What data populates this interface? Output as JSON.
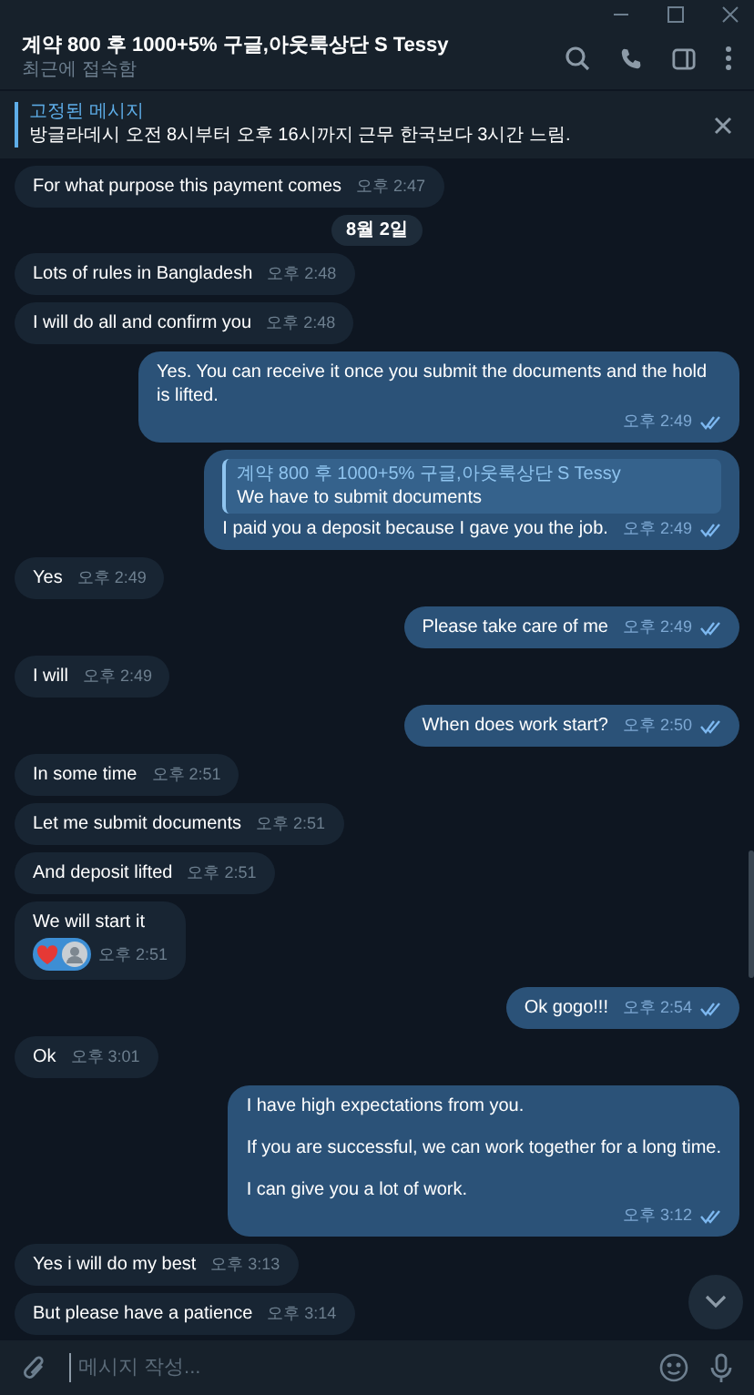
{
  "header": {
    "title": "계약 800 후 1000+5% 구글,아웃룩상단 S Tessy",
    "status": "최근에 접속함"
  },
  "pinned": {
    "label": "고정된 메시지",
    "text": "방글라데시  오전 8시부터 오후 16시까지 근무 한국보다 3시간 느림."
  },
  "messages": [
    {
      "kind": "in",
      "paragraphs": [
        "For what purpose this payment comes"
      ],
      "time": "오후 2:47"
    },
    {
      "kind": "date",
      "text": "8월 2일"
    },
    {
      "kind": "in",
      "paragraphs": [
        "Lots of rules in Bangladesh"
      ],
      "time": "오후 2:48"
    },
    {
      "kind": "in",
      "paragraphs": [
        "I will do all and confirm you"
      ],
      "time": "오후 2:48"
    },
    {
      "kind": "out",
      "paragraphs": [
        "Yes. You can receive it once you submit the documents and the hold is lifted."
      ],
      "time": "오후 2:49",
      "read": true
    },
    {
      "kind": "out",
      "reply": {
        "author": "계약 800 후 1000+5% 구글,아웃룩상단 S Tessy",
        "text": "We have to submit documents"
      },
      "paragraphs": [
        "I paid you a deposit because I gave you the job."
      ],
      "time": "오후 2:49",
      "read": true
    },
    {
      "kind": "in",
      "paragraphs": [
        "Yes"
      ],
      "time": "오후 2:49"
    },
    {
      "kind": "out",
      "paragraphs": [
        "Please take care of me"
      ],
      "time": "오후 2:49",
      "read": true
    },
    {
      "kind": "in",
      "paragraphs": [
        "I will"
      ],
      "time": "오후 2:49"
    },
    {
      "kind": "out",
      "paragraphs": [
        "When does work start?"
      ],
      "time": "오후 2:50",
      "read": true
    },
    {
      "kind": "in",
      "paragraphs": [
        "In some time"
      ],
      "time": "오후 2:51"
    },
    {
      "kind": "in",
      "paragraphs": [
        "Let me submit documents"
      ],
      "time": "오후 2:51"
    },
    {
      "kind": "in",
      "paragraphs": [
        "And deposit lifted"
      ],
      "time": "오후 2:51"
    },
    {
      "kind": "in",
      "paragraphs": [
        "We will start it"
      ],
      "time": "오후 2:51",
      "reactions": [
        {
          "kind": "heart"
        },
        {
          "kind": "avatar"
        }
      ]
    },
    {
      "kind": "out",
      "paragraphs": [
        "Ok gogo!!!"
      ],
      "time": "오후 2:54",
      "read": true
    },
    {
      "kind": "in",
      "paragraphs": [
        "Ok"
      ],
      "time": "오후 3:01"
    },
    {
      "kind": "out",
      "paragraphs": [
        "I have high expectations from you.",
        "If you are successful, we can work together for a long time.",
        "I can give you a lot of work."
      ],
      "time": "오후 3:12",
      "read": true
    },
    {
      "kind": "in",
      "paragraphs": [
        "Yes i will do my best"
      ],
      "time": "오후 3:13"
    },
    {
      "kind": "in",
      "paragraphs": [
        "But please have a patience"
      ],
      "time": "오후 3:14"
    }
  ],
  "composer": {
    "placeholder": "메시지 작성..."
  }
}
